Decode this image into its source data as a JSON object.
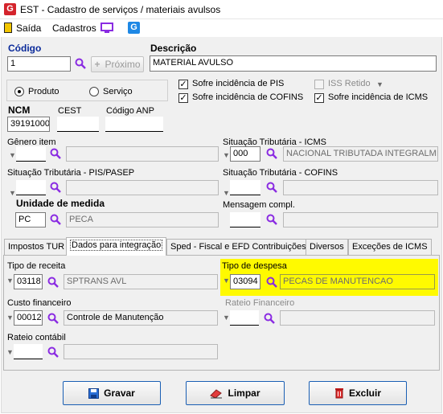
{
  "window": {
    "title": "EST - Cadastro de serviços / materiais avulsos",
    "logo_letter": "G"
  },
  "menu": {
    "saida": "Saída",
    "cadastros": "Cadastros"
  },
  "codigo": {
    "label": "Código",
    "value": "1",
    "next_label": "Próximo"
  },
  "descricao": {
    "label": "Descrição",
    "value": "MATERIAL AVULSO"
  },
  "tipo": {
    "produto": "Produto",
    "servico": "Serviço",
    "selected": "Produto"
  },
  "checks": {
    "pis": {
      "label": "Sofre incidência de PIS",
      "checked": true
    },
    "cofins": {
      "label": "Sofre incidência de COFINS",
      "checked": true
    },
    "iss": {
      "label": "ISS Retido",
      "checked": false
    },
    "icms": {
      "label": "Sofre incidência de ICMS",
      "checked": true
    }
  },
  "ncm": {
    "label": "NCM",
    "value": "39191000"
  },
  "cest": {
    "label": "CEST",
    "value": ""
  },
  "codigo_anp": {
    "label": "Código ANP",
    "value": ""
  },
  "genero_item": {
    "label": "Gênero item",
    "code": "",
    "desc": ""
  },
  "sit_icms": {
    "label": "Situação Tributária - ICMS",
    "code": "000",
    "desc": "NACIONAL TRIBUTADA INTEGRALMI"
  },
  "sit_pis": {
    "label": "Situação Tributária - PIS/PASEP",
    "code": "",
    "desc": ""
  },
  "sit_cofins": {
    "label": "Situação Tributária - COFINS",
    "code": "",
    "desc": ""
  },
  "unidade": {
    "label": "Unidade de medida",
    "code": "PC",
    "desc": "PECA"
  },
  "mensagem": {
    "label": "Mensagem compl.",
    "code": "",
    "desc": ""
  },
  "tabs": [
    {
      "label": "Impostos TUR"
    },
    {
      "label": "Dados para integração"
    },
    {
      "label": "Sped - Fiscal e EFD Contribuições"
    },
    {
      "label": "Diversos"
    },
    {
      "label": "Exceções de ICMS"
    }
  ],
  "integracao": {
    "tipo_receita": {
      "label": "Tipo de receita",
      "code": "03118",
      "desc": "SPTRANS AVL"
    },
    "tipo_despesa": {
      "label": "Tipo de despesa",
      "code": "03094",
      "desc": "PECAS DE MANUTENCAO"
    },
    "custo_financeiro": {
      "label": "Custo financeiro",
      "code": "00012",
      "desc": "Controle de Manutenção"
    },
    "rateio_financeiro": {
      "label": "Rateio Financeiro",
      "code": "",
      "desc": ""
    },
    "rateio_contabil": {
      "label": "Rateio contábil",
      "code": "",
      "desc": ""
    }
  },
  "buttons": {
    "gravar": "Gravar",
    "limpar": "Limpar",
    "excluir": "Excluir"
  },
  "colors": {
    "highlight": "#fffa00",
    "label_blue": "#0a2a9a",
    "accent_purple": "#8a2be2"
  }
}
